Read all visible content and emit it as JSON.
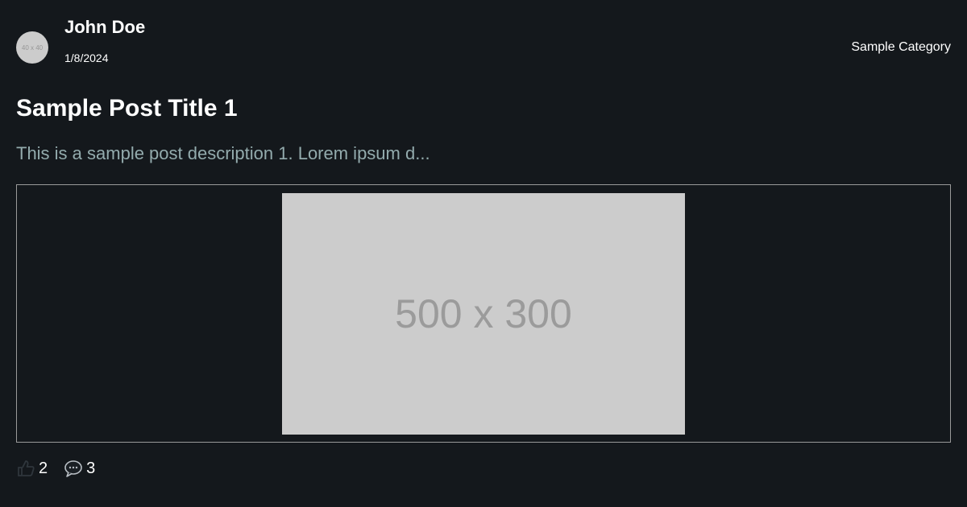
{
  "author": {
    "name": "John Doe",
    "avatar_placeholder": "40 x 40",
    "date": "1/8/2024"
  },
  "category": "Sample Category",
  "post": {
    "title": "Sample Post Title 1",
    "description": "This is a sample post description 1. Lorem ipsum d...",
    "image_placeholder": "500 x 300"
  },
  "actions": {
    "likes": "2",
    "comments": "3",
    "like_icon": "thumbs-up-icon",
    "comment_icon": "speech-bubble-icon"
  },
  "colors": {
    "background": "#14181c",
    "text": "#ffffff",
    "description": "#93abad",
    "placeholder": "#cccccc",
    "frame_border": "#9a9a9a"
  }
}
